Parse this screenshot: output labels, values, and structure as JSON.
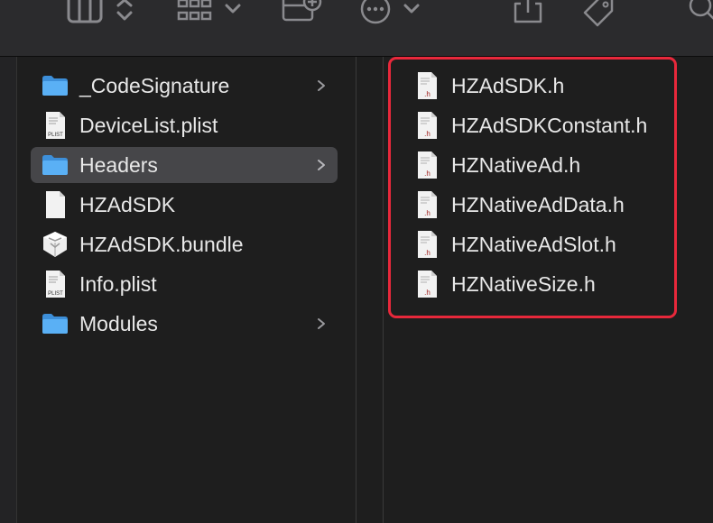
{
  "toolbar": {
    "icons": [
      "columns-view-icon",
      "up-down-chevron-icon",
      "grid-view-icon",
      "chevron-down-icon",
      "new-folder-icon",
      "more-icon",
      "chevron-down-icon",
      "share-icon",
      "tag-icon",
      "search-icon"
    ]
  },
  "column1": {
    "items": [
      {
        "label": "_CodeSignature",
        "icon": "folder-icon",
        "has_children": true
      },
      {
        "label": "DeviceList.plist",
        "icon": "plist-file-icon",
        "has_children": false
      },
      {
        "label": "Headers",
        "icon": "folder-icon",
        "has_children": true,
        "selected": true
      },
      {
        "label": "HZAdSDK",
        "icon": "blank-file-icon",
        "has_children": false
      },
      {
        "label": "HZAdSDK.bundle",
        "icon": "bundle-icon",
        "has_children": false
      },
      {
        "label": "Info.plist",
        "icon": "plist-file-icon",
        "has_children": false
      },
      {
        "label": "Modules",
        "icon": "folder-icon",
        "has_children": true
      }
    ]
  },
  "column2": {
    "items": [
      {
        "label": "HZAdSDK.h",
        "icon": "header-file-icon"
      },
      {
        "label": "HZAdSDKConstant.h",
        "icon": "header-file-icon"
      },
      {
        "label": "HZNativeAd.h",
        "icon": "header-file-icon"
      },
      {
        "label": "HZNativeAdData.h",
        "icon": "header-file-icon"
      },
      {
        "label": "HZNativeAdSlot.h",
        "icon": "header-file-icon"
      },
      {
        "label": "HZNativeSize.h",
        "icon": "header-file-icon"
      }
    ]
  },
  "file_badges": {
    "plist": "PLIST",
    "header": ".h"
  },
  "colors": {
    "folder": "#4aa3f0",
    "highlight": "#e8283b",
    "selection": "#464649"
  }
}
